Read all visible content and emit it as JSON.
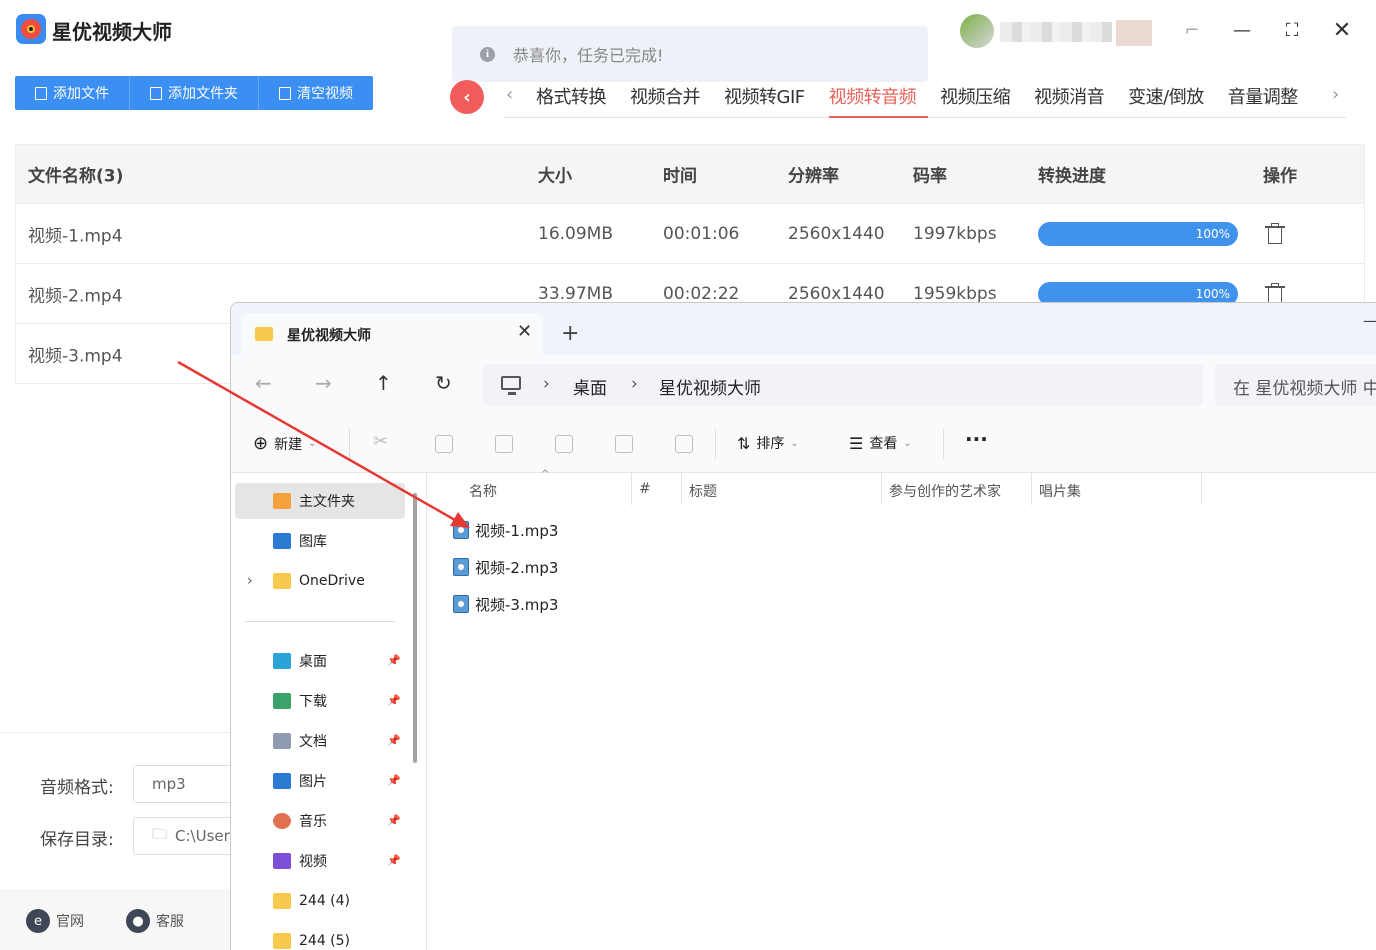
{
  "app": {
    "title": "星优视频大师",
    "toast": "恭喜你，任务已完成!",
    "toolbar": {
      "add_file": "添加文件",
      "add_folder": "添加文件夹",
      "clear": "清空视频"
    },
    "tabs": [
      "格式转换",
      "视频合并",
      "视频转GIF",
      "视频转音频",
      "视频压缩",
      "视频消音",
      "变速/倒放",
      "音量调整"
    ],
    "active_tab": "视频转音频",
    "table": {
      "headers": [
        "文件名称(3)",
        "大小",
        "时间",
        "分辨率",
        "码率",
        "转换进度",
        "操作"
      ],
      "rows": [
        {
          "name": "视频-1.mp4",
          "size": "16.09MB",
          "time": "00:01:06",
          "res": "2560x1440",
          "bitrate": "1997kbps",
          "progress": "100%"
        },
        {
          "name": "视频-2.mp4",
          "size": "33.97MB",
          "time": "00:02:22",
          "res": "2560x1440",
          "bitrate": "1959kbps",
          "progress": "100%"
        },
        {
          "name": "视频-3.mp4"
        }
      ]
    },
    "audio_format_label": "音频格式:",
    "audio_format_value": "mp3",
    "save_dir_label": "保存目录:",
    "save_dir_value": "C:\\Users",
    "website": "官网",
    "service": "客服",
    "accent_color": "#3b8ff2",
    "active_color": "#e8615a"
  },
  "explorer": {
    "tab_title": "星优视频大师",
    "breadcrumb": [
      "桌面",
      "星优视频大师"
    ],
    "search_placeholder": "在 星优视频大师 中",
    "commands": {
      "new": "新建",
      "sort": "排序",
      "view": "查看"
    },
    "sidebar": [
      "主文件夹",
      "图库",
      "OneDrive",
      "桌面",
      "下载",
      "文档",
      "图片",
      "音乐",
      "视频",
      "244 (4)",
      "244 (5)"
    ],
    "columns": [
      "名称",
      "#",
      "标题",
      "参与创作的艺术家",
      "唱片集"
    ],
    "files": [
      "视频-1.mp3",
      "视频-2.mp3",
      "视频-3.mp3"
    ]
  }
}
